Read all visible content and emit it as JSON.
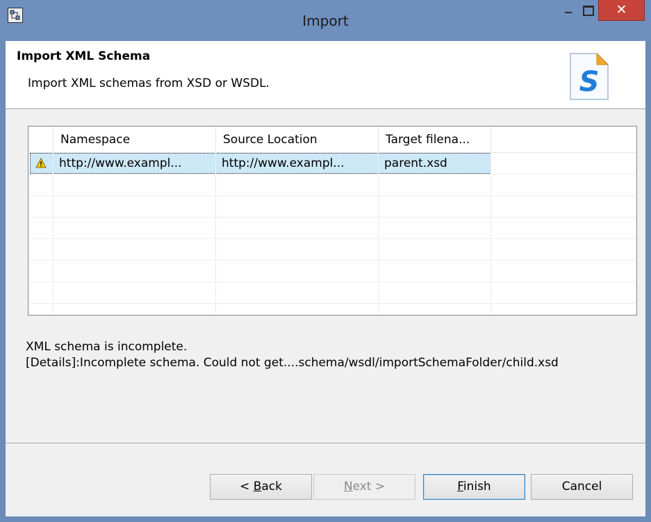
{
  "window": {
    "title": "Import",
    "close_glyph": "✕"
  },
  "header": {
    "title": "Import XML Schema",
    "description": "Import XML schemas from XSD or WSDL.",
    "image_letter": "S"
  },
  "table": {
    "columns": [
      "",
      "Namespace",
      "Source Location",
      "Target filena..."
    ],
    "rows": [
      {
        "status_icon": "warning-icon",
        "namespace": "http://www.exampl...",
        "source_location": "http://www.exampl...",
        "target_filename": "parent.xsd",
        "selected": true
      }
    ]
  },
  "message": {
    "line1": "XML schema is incomplete.",
    "line2": "[Details]:Incomplete schema. Could not get....schema/wsdl/importSchemaFolder/child.xsd"
  },
  "buttons": {
    "back_prefix": "< ",
    "back_mnemonic": "B",
    "back_rest": "ack",
    "next_mnemonic": "N",
    "next_rest": "ext >",
    "finish_mnemonic": "F",
    "finish_rest": "inish",
    "cancel": "Cancel"
  },
  "colors": {
    "titlebar": "#6f8fbf",
    "close": "#c7443a",
    "selection": "#cde8f7"
  }
}
